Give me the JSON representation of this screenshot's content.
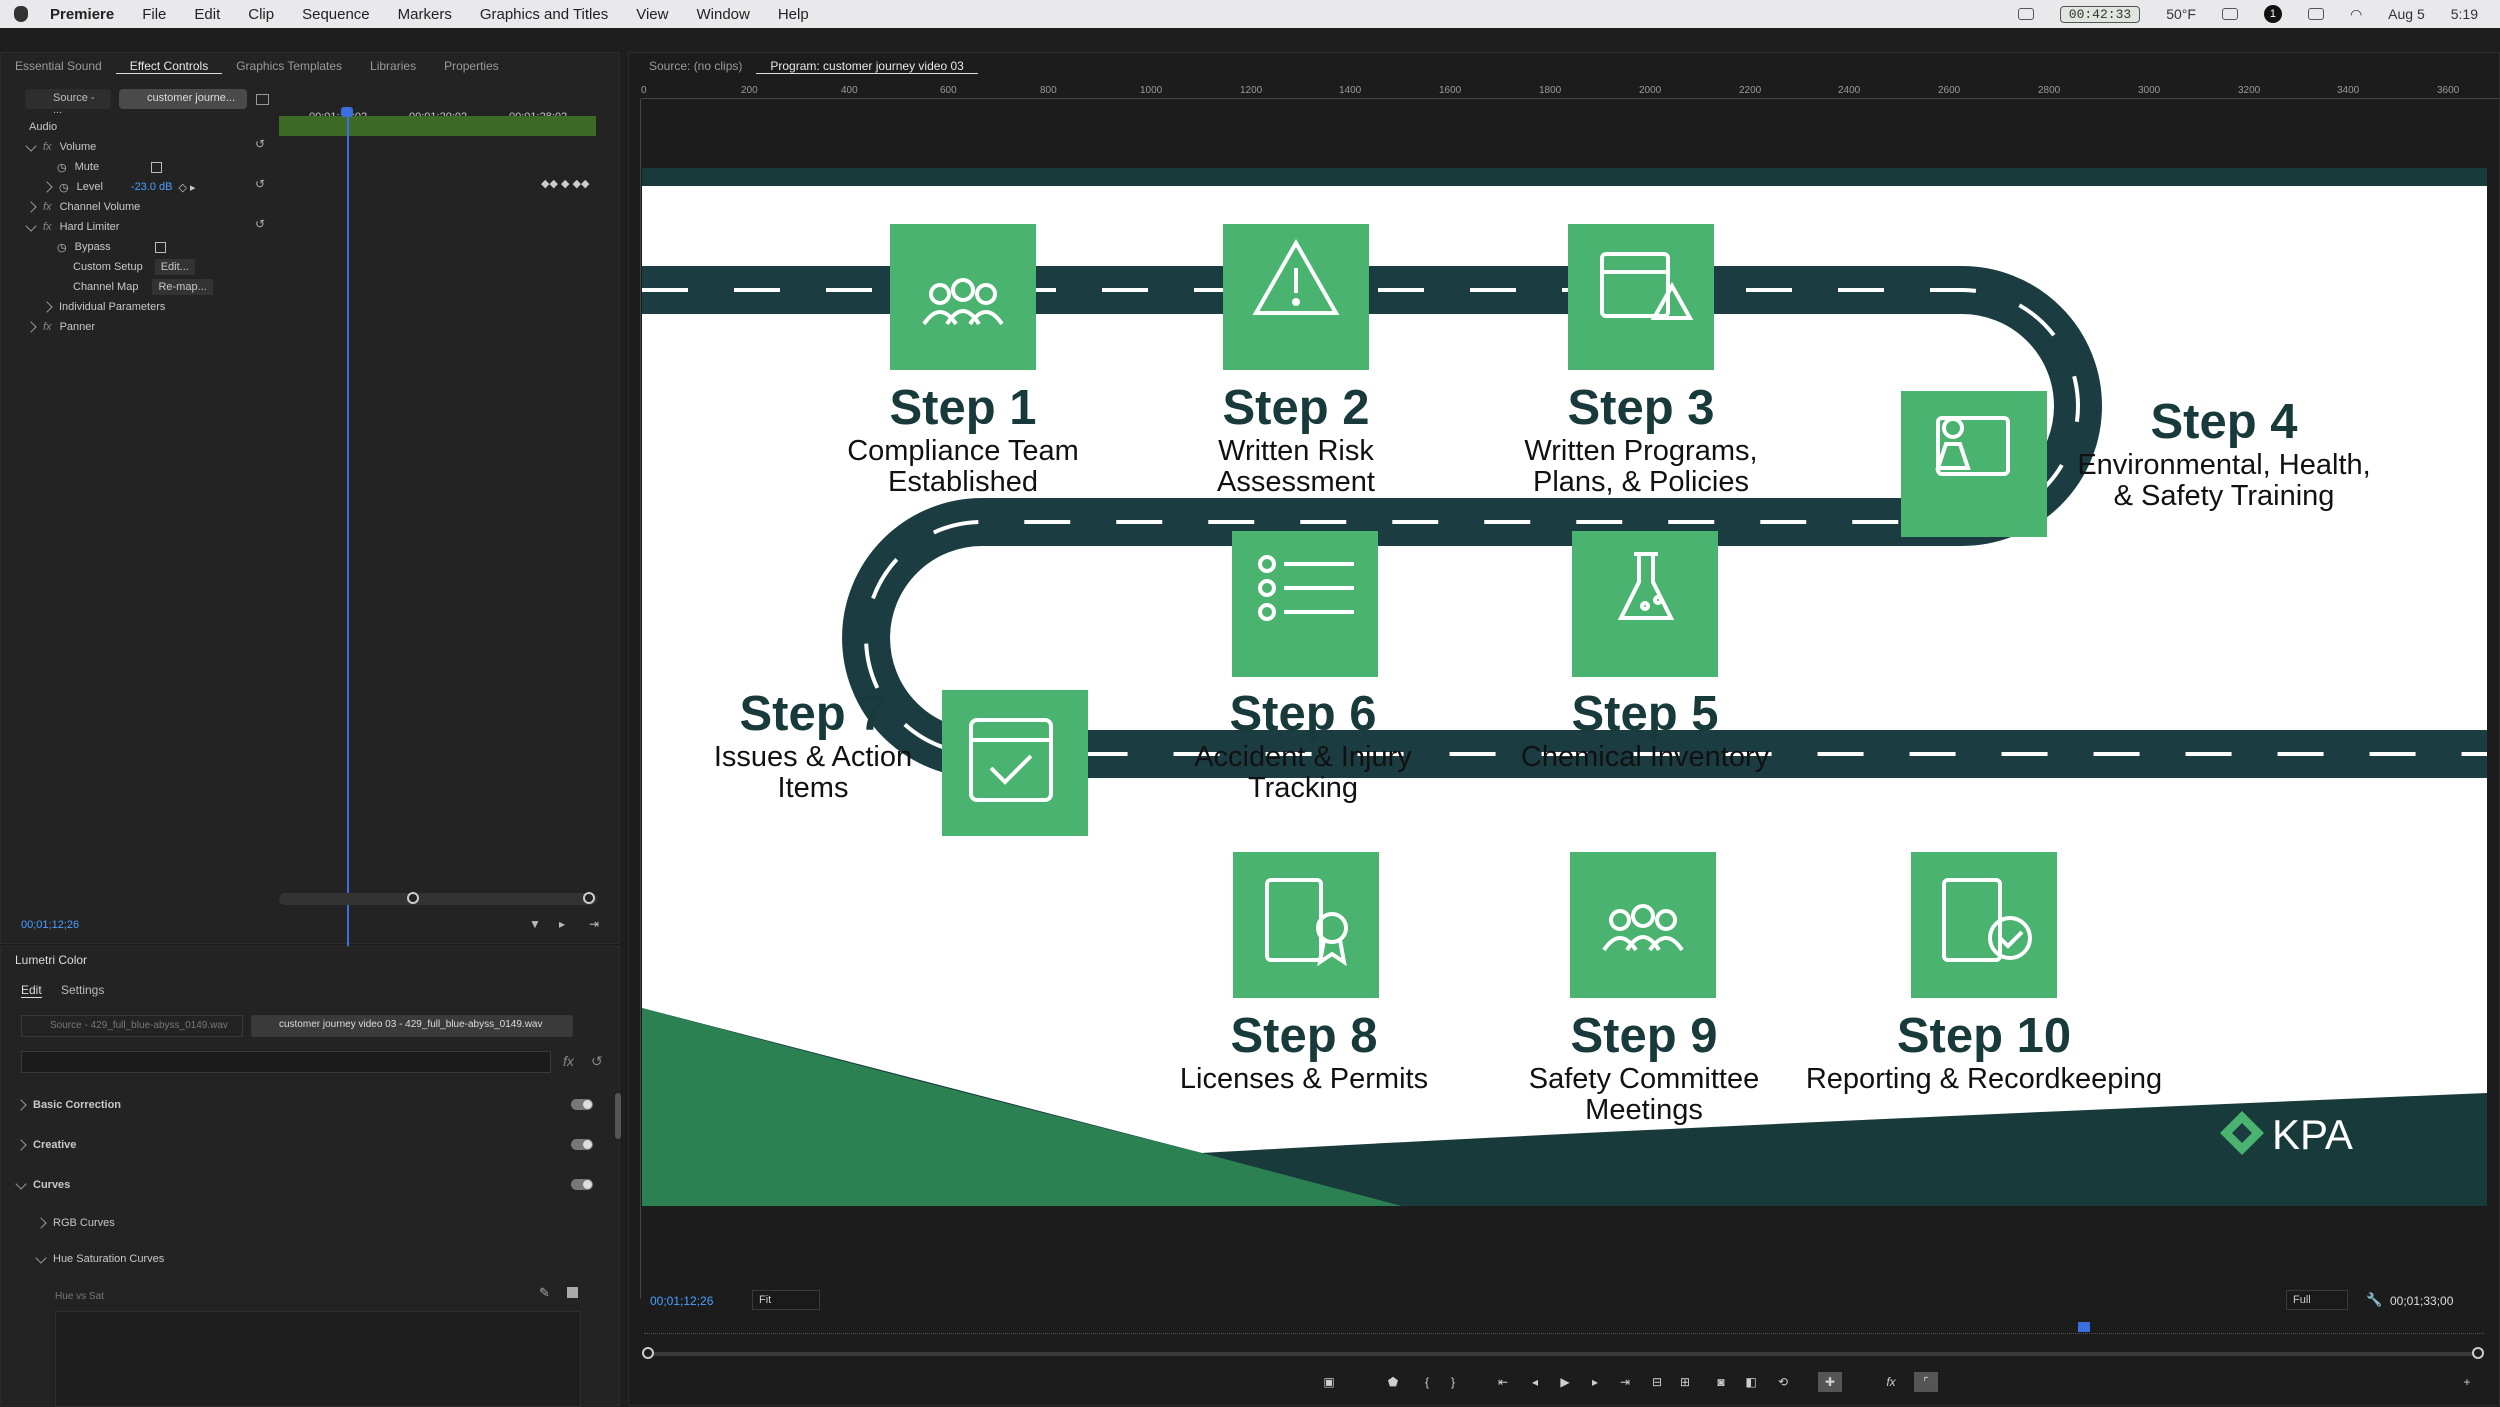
{
  "menubar": {
    "app": "Premiere",
    "items": [
      "File",
      "Edit",
      "Clip",
      "Sequence",
      "Markers",
      "Graphics and Titles",
      "View",
      "Window",
      "Help"
    ],
    "status": {
      "timer": "00:42:33",
      "weather": "50°F",
      "badge": "1",
      "date": "Aug 5",
      "time": "5:19"
    }
  },
  "left_panel": {
    "tabs": [
      "Essential Sound",
      "Effect Controls",
      "Graphics Templates",
      "Libraries",
      "Properties"
    ],
    "active_tab": "Effect Controls",
    "source_tab": "Source - ...",
    "clip_tab": "customer journe...",
    "timecodes": [
      "00;01;12;02",
      "00;01;20;02",
      "00;01;28;02"
    ],
    "section": "Audio",
    "rows": [
      {
        "label": "Volume",
        "type": "fx"
      },
      {
        "label": "Mute",
        "type": "check"
      },
      {
        "label": "Level",
        "type": "value",
        "value": "-23.0 dB"
      },
      {
        "label": "Channel Volume",
        "type": "fx"
      },
      {
        "label": "Hard Limiter",
        "type": "fx"
      },
      {
        "label": "Bypass",
        "type": "check"
      },
      {
        "label": "Custom Setup",
        "type": "button",
        "button": "Edit..."
      },
      {
        "label": "Channel Map",
        "type": "button",
        "button": "Re-map..."
      },
      {
        "label": "Individual Parameters",
        "type": "sub"
      },
      {
        "label": "Panner",
        "type": "fx"
      }
    ],
    "current_time": "00;01;12;26"
  },
  "lumetri": {
    "title": "Lumetri Color",
    "tabs": [
      "Edit",
      "Settings"
    ],
    "source": "Source - 429_full_blue-abyss_0149.wav",
    "clip": "customer journey video 03 - 429_full_blue-abyss_0149.wav",
    "sections": [
      "Basic Correction",
      "Creative",
      "Curves"
    ],
    "subsections": [
      "RGB Curves",
      "Hue Saturation Curves"
    ],
    "hue_label": "Hue vs Sat"
  },
  "monitor": {
    "source_tab": "Source: (no clips)",
    "program_tab": "Program: customer journey video 03",
    "ruler": [
      "0",
      "200",
      "400",
      "600",
      "800",
      "1000",
      "1200",
      "1400",
      "1600",
      "1800",
      "2000",
      "2200",
      "2400",
      "2600",
      "2800",
      "3000",
      "3200",
      "3400",
      "3600"
    ],
    "current_time": "00;01;12;26",
    "fit": "Fit",
    "quality": "Full",
    "duration": "00;01;33;00"
  },
  "slide": {
    "colors": {
      "road": "#1b3d42",
      "tile": "#4ab36f",
      "dark": "#183a3a"
    },
    "logo": "KPA",
    "steps": [
      {
        "title": "Step 1",
        "desc": "Compliance Team\nEstablished",
        "icon": "team-icon"
      },
      {
        "title": "Step 2",
        "desc": "Written Risk\nAssessment",
        "icon": "warning-icon"
      },
      {
        "title": "Step 3",
        "desc": "Written Programs,\nPlans, & Policies",
        "icon": "calendar-warning-icon"
      },
      {
        "title": "Step 4",
        "desc": "Environmental, Health,\n& Safety Training",
        "icon": "presenter-icon"
      },
      {
        "title": "Step 5",
        "desc": "Chemical Inventory",
        "icon": "flask-icon"
      },
      {
        "title": "Step 6",
        "desc": "Accident & Injury\nTracking",
        "icon": "list-icon"
      },
      {
        "title": "Step 7",
        "desc": "Issues & Action\nItems",
        "icon": "calendar-check-icon"
      },
      {
        "title": "Step 8",
        "desc": "Licenses & Permits",
        "icon": "certificate-icon"
      },
      {
        "title": "Step 9",
        "desc": "Safety Committee\nMeetings",
        "icon": "team-icon"
      },
      {
        "title": "Step 10",
        "desc": "Reporting & Recordkeeping",
        "icon": "report-icon"
      }
    ]
  }
}
